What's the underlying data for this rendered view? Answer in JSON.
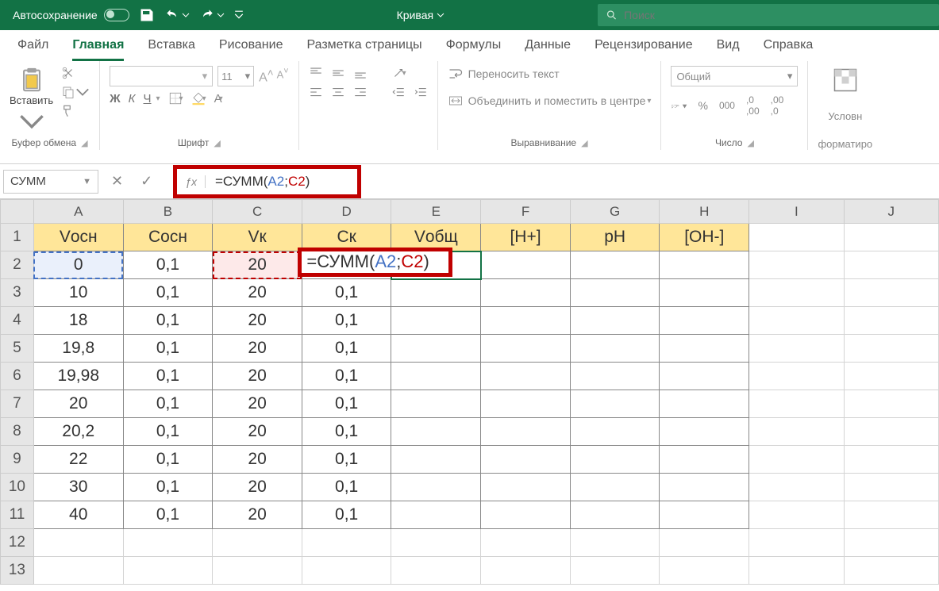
{
  "title_bar": {
    "autosave": "Автосохранение",
    "doc_name": "Кривая",
    "search_placeholder": "Поиск"
  },
  "tabs": {
    "file": "Файл",
    "home": "Главная",
    "insert": "Вставка",
    "draw": "Рисование",
    "layout": "Разметка страницы",
    "formulas": "Формулы",
    "data": "Данные",
    "review": "Рецензирование",
    "view": "Вид",
    "help": "Справка"
  },
  "ribbon": {
    "paste": "Вставить",
    "clipboard": "Буфер обмена",
    "font_size": "11",
    "font_group": "Шрифт",
    "wrap": "Переносить текст",
    "merge": "Объединить и поместить в центре",
    "align_group": "Выравнивание",
    "number_format": "Общий",
    "number_group": "Число",
    "cond_format_l1": "Условн",
    "cond_format_l2": "форматиро"
  },
  "name_box": "СУММ",
  "formula": {
    "prefix": "=СУММ(",
    "ref1": "A2",
    "sep": ";",
    "ref2": "C2",
    "suffix": ")"
  },
  "columns": [
    "A",
    "B",
    "C",
    "D",
    "E",
    "F",
    "G",
    "H",
    "I",
    "J"
  ],
  "headers": [
    "Vосн",
    "Сосн",
    "Vк",
    "Ск",
    "Vобщ",
    "[H+]",
    "pH",
    "[OH-]"
  ],
  "data_rows": [
    {
      "r": "2",
      "a": "0",
      "b": "0,1",
      "c": "20",
      "d": "=СУММ(A2;C2)"
    },
    {
      "r": "3",
      "a": "10",
      "b": "0,1",
      "c": "20",
      "d": "0,1"
    },
    {
      "r": "4",
      "a": "18",
      "b": "0,1",
      "c": "20",
      "d": "0,1"
    },
    {
      "r": "5",
      "a": "19,8",
      "b": "0,1",
      "c": "20",
      "d": "0,1"
    },
    {
      "r": "6",
      "a": "19,98",
      "b": "0,1",
      "c": "20",
      "d": "0,1"
    },
    {
      "r": "7",
      "a": "20",
      "b": "0,1",
      "c": "20",
      "d": "0,1"
    },
    {
      "r": "8",
      "a": "20,2",
      "b": "0,1",
      "c": "20",
      "d": "0,1"
    },
    {
      "r": "9",
      "a": "22",
      "b": "0,1",
      "c": "20",
      "d": "0,1"
    },
    {
      "r": "10",
      "a": "30",
      "b": "0,1",
      "c": "20",
      "d": "0,1"
    },
    {
      "r": "11",
      "a": "40",
      "b": "0,1",
      "c": "20",
      "d": "0,1"
    }
  ],
  "empty_rows": [
    "12",
    "13"
  ]
}
